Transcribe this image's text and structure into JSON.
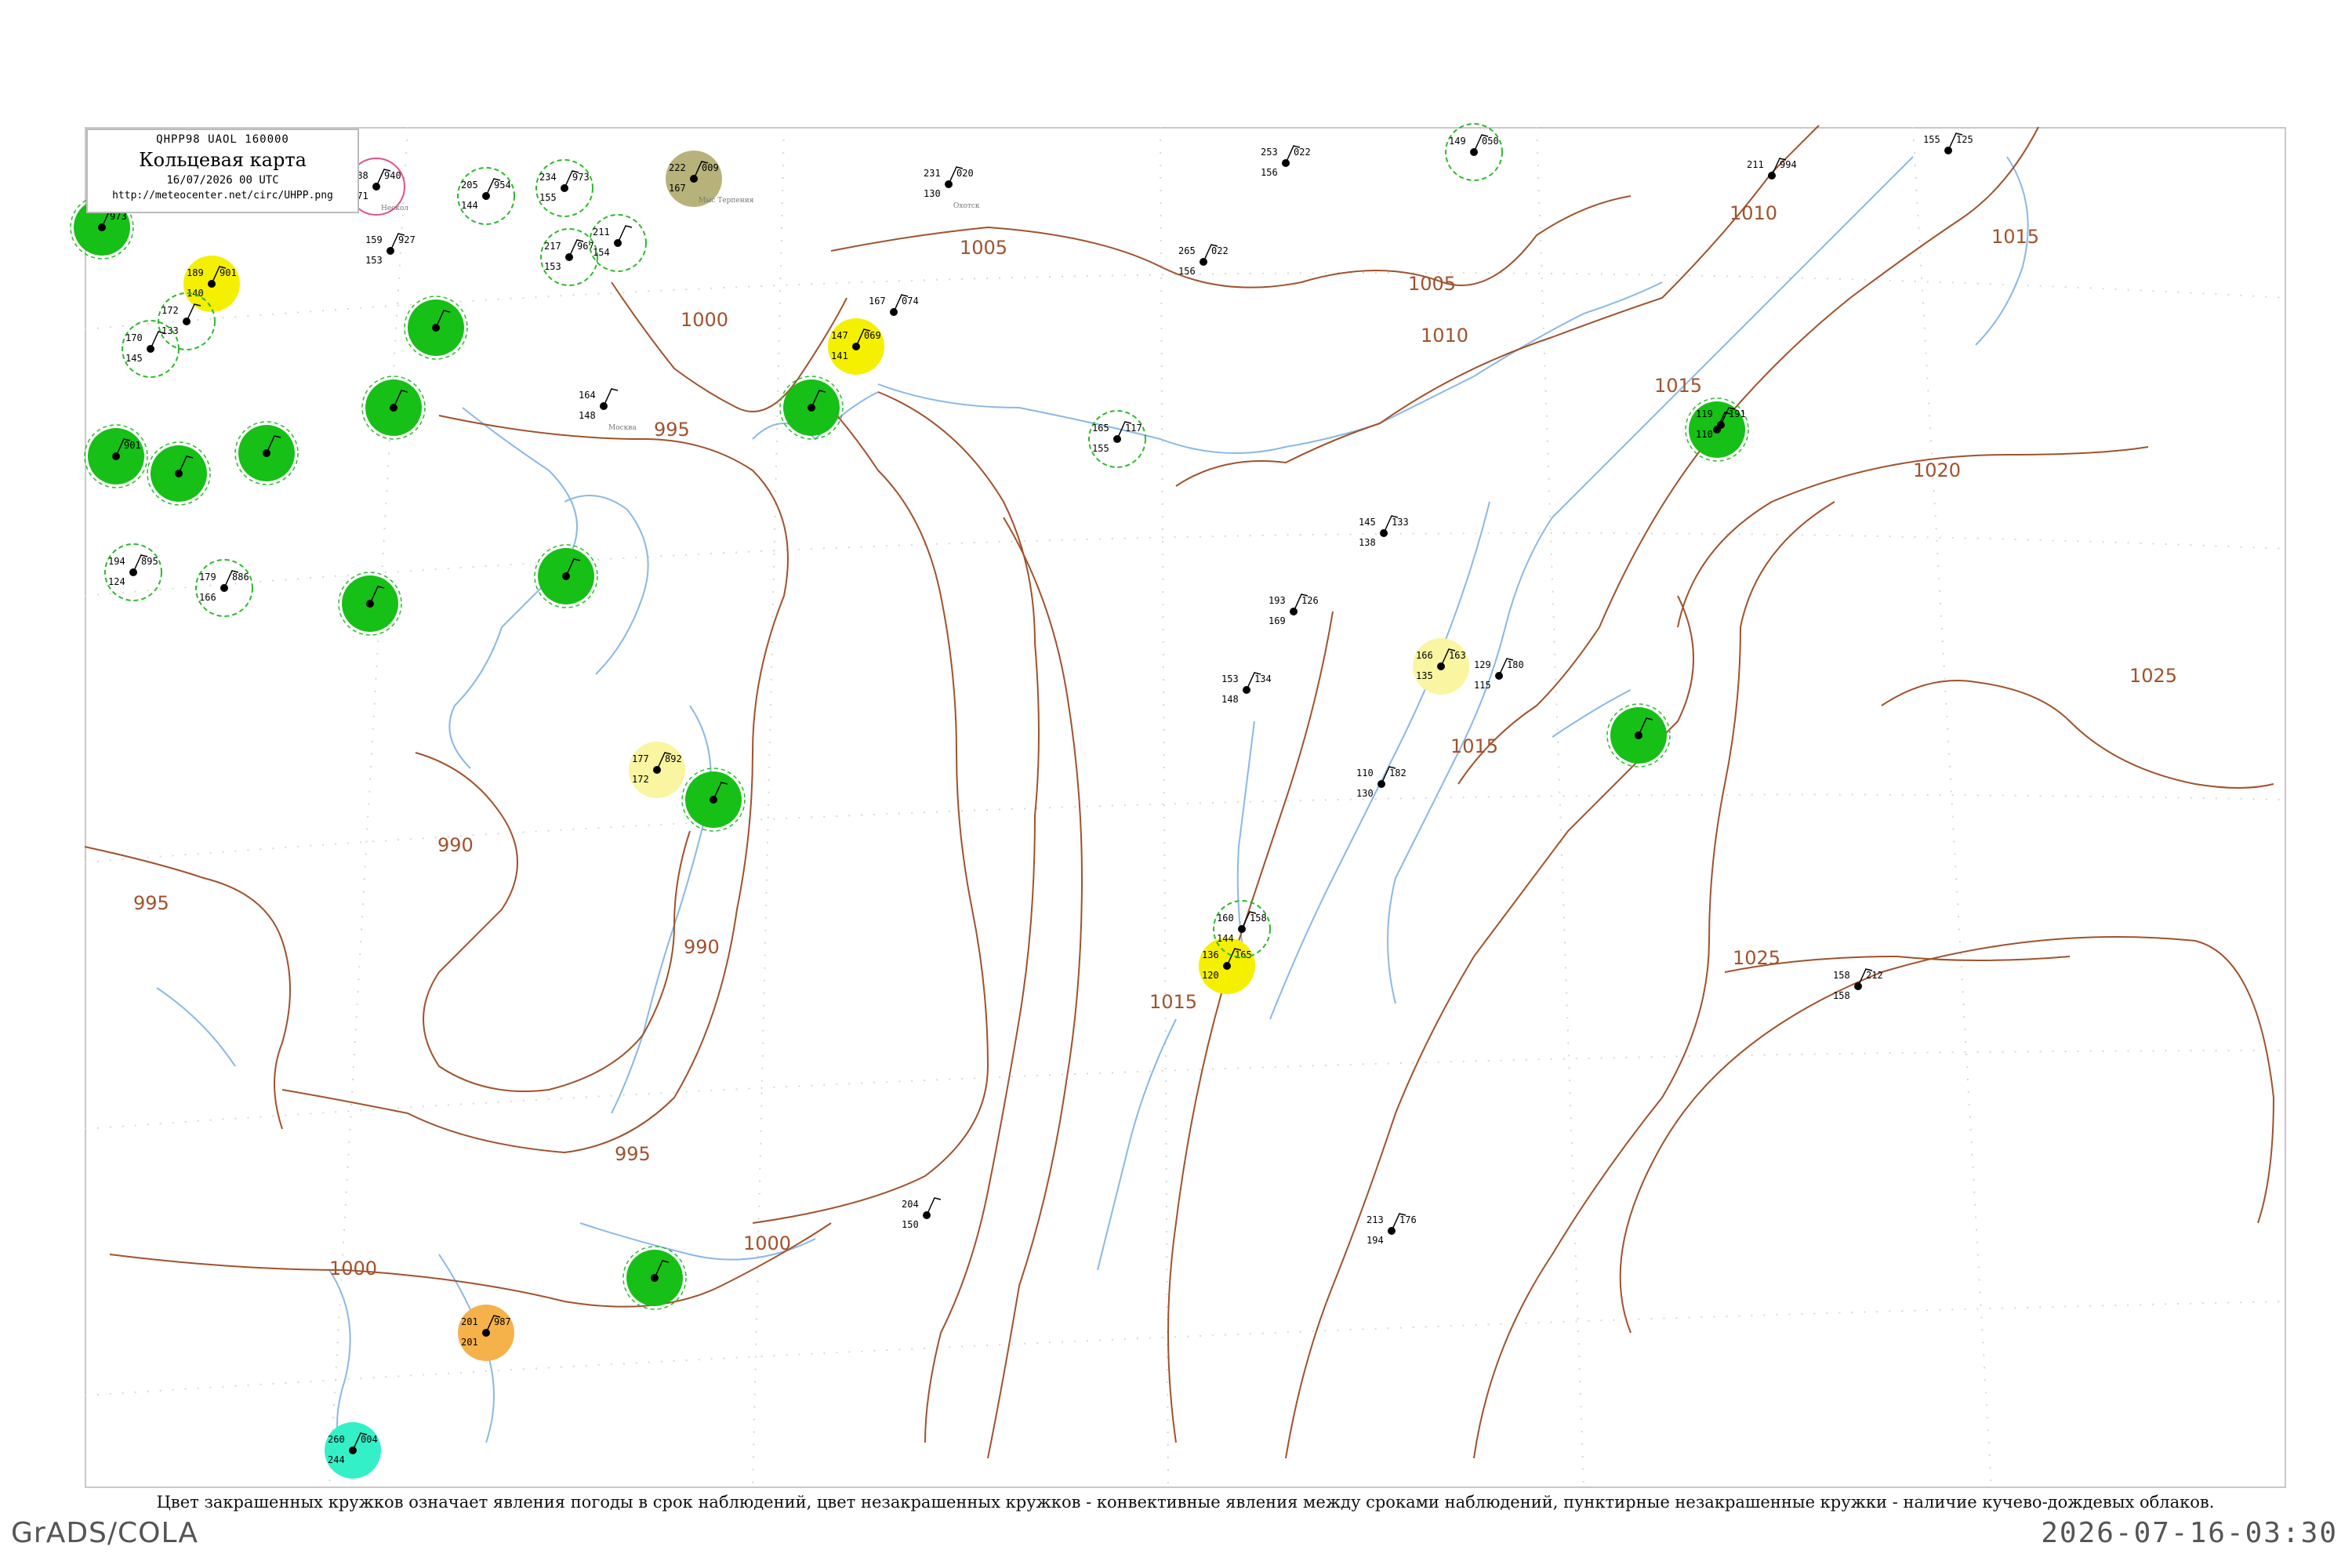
{
  "title": {
    "code": "QHPP98  UAOL  160000",
    "name": "Кольцевая карта",
    "date": "16/07/2026 00 UTC",
    "url": "http://meteocenter.net/circ/UHPP.png"
  },
  "caption": "Цвет закрашенных кружков означает явления погоды в срок наблюдений, цвет незакрашенных кружков - конвективные явления между сроками наблюдений, пунктирные незакрашенные кружки - наличие кучево-дождевых облаков.",
  "footer": {
    "software": "GrADS/COLA",
    "timestamp": "2026-07-16-03:30"
  },
  "colors": {
    "isobar": "#a0522d",
    "river": "#8ab8e6",
    "station_green": "#16c016",
    "station_yellow": "#f5f000",
    "station_paleyellow": "#faf5a0",
    "station_olive": "#b7b27a",
    "station_orange": "#f5b24a",
    "station_cyan": "#33f0c8",
    "ring_green": "#2db82d",
    "ring_pink": "#e0508a"
  },
  "isobar_labels": [
    "1005",
    "1005",
    "1010",
    "1010",
    "1015",
    "1015",
    "1015",
    "1020",
    "1025",
    "1025",
    "1000",
    "995",
    "995",
    "990",
    "990",
    "995",
    "1000",
    "1000",
    "1015"
  ],
  "stations": [
    {
      "id": "s1",
      "fill": "green",
      "t": "",
      "p": "973",
      "td": "",
      "name": ""
    },
    {
      "id": "s2",
      "fill": "none-pink",
      "t": "188",
      "p": "940",
      "td": "171",
      "name": "Нескол"
    },
    {
      "id": "s3",
      "fill": "none-ring",
      "t": "205",
      "p": "954",
      "td": "144",
      "name": ""
    },
    {
      "id": "s4",
      "fill": "none-ring",
      "t": "234",
      "p": "973",
      "td": "155",
      "name": ""
    },
    {
      "id": "s5",
      "fill": "olive",
      "t": "222",
      "p": "009",
      "td": "167",
      "name": "Мыс Терпения"
    },
    {
      "id": "s6",
      "fill": "none",
      "t": "231",
      "p": "020",
      "td": "130",
      "name": "Охотск"
    },
    {
      "id": "s7",
      "fill": "none",
      "t": "253",
      "p": "022",
      "td": "156",
      "name": ""
    },
    {
      "id": "s8",
      "fill": "none-ring",
      "t": "149",
      "p": "050",
      "td": "",
      "name": ""
    },
    {
      "id": "s9",
      "fill": "none",
      "t": "155",
      "p": "125",
      "td": "",
      "name": ""
    },
    {
      "id": "s10",
      "fill": "none",
      "t": "211",
      "p": "994",
      "td": "",
      "name": ""
    },
    {
      "id": "s11",
      "fill": "yellow",
      "t": "189",
      "p": "901",
      "td": "140",
      "name": ""
    },
    {
      "id": "s12",
      "fill": "none-ring",
      "t": "172",
      "p": "",
      "td": "133",
      "name": ""
    },
    {
      "id": "s13",
      "fill": "none-ring",
      "t": "170",
      "p": "",
      "td": "145",
      "name": ""
    },
    {
      "id": "s14",
      "fill": "green",
      "t": "",
      "p": "",
      "td": "",
      "name": ""
    },
    {
      "id": "s15",
      "fill": "green",
      "t": "",
      "p": "",
      "td": "",
      "name": ""
    },
    {
      "id": "s16",
      "fill": "none",
      "t": "159",
      "p": "927",
      "td": "153",
      "name": ""
    },
    {
      "id": "s17",
      "fill": "none-ring",
      "t": "217",
      "p": "967",
      "td": "153",
      "name": ""
    },
    {
      "id": "s18",
      "fill": "none-ring",
      "t": "211",
      "p": "",
      "td": "154",
      "name": ""
    },
    {
      "id": "s19",
      "fill": "none",
      "t": "265",
      "p": "022",
      "td": "156",
      "name": ""
    },
    {
      "id": "s20",
      "fill": "yellow",
      "t": "147",
      "p": "069",
      "td": "141",
      "name": ""
    },
    {
      "id": "s21",
      "fill": "none",
      "t": "167",
      "p": "074",
      "td": "",
      "name": ""
    },
    {
      "id": "s22",
      "fill": "green",
      "t": "",
      "p": "",
      "td": "",
      "name": ""
    },
    {
      "id": "s23",
      "fill": "none",
      "t": "164",
      "p": "",
      "td": "148",
      "name": "Москва"
    },
    {
      "id": "s24",
      "fill": "none-ring",
      "t": "165",
      "p": "117",
      "td": "155",
      "name": ""
    },
    {
      "id": "s25",
      "fill": "green",
      "t": "",
      "p": "901",
      "td": "",
      "name": ""
    },
    {
      "id": "s26",
      "fill": "green",
      "t": "",
      "p": "",
      "td": "",
      "name": ""
    },
    {
      "id": "s27",
      "fill": "green",
      "t": "",
      "p": "",
      "td": "",
      "name": ""
    },
    {
      "id": "s28",
      "fill": "green",
      "t": "",
      "p": "",
      "td": "",
      "name": ""
    },
    {
      "id": "s29",
      "fill": "none",
      "t": "119",
      "p": "191",
      "td": "110",
      "name": ""
    },
    {
      "id": "s30",
      "fill": "none",
      "t": "145",
      "p": "133",
      "td": "138",
      "name": ""
    },
    {
      "id": "s31",
      "fill": "none-ring",
      "t": "194",
      "p": "895",
      "td": "124",
      "name": ""
    },
    {
      "id": "s32",
      "fill": "none-ring",
      "t": "179",
      "p": "886",
      "td": "166",
      "name": ""
    },
    {
      "id": "s33",
      "fill": "green",
      "t": "",
      "p": "",
      "td": "",
      "name": ""
    },
    {
      "id": "s34",
      "fill": "green",
      "t": "",
      "p": "",
      "td": "",
      "name": ""
    },
    {
      "id": "s35",
      "fill": "none",
      "t": "193",
      "p": "126",
      "td": "169",
      "name": ""
    },
    {
      "id": "s36",
      "fill": "paleyellow",
      "t": "166",
      "p": "163",
      "td": "135",
      "name": ""
    },
    {
      "id": "s37",
      "fill": "none",
      "t": "153",
      "p": "134",
      "td": "148",
      "name": ""
    },
    {
      "id": "s38",
      "fill": "none",
      "t": "129",
      "p": "180",
      "td": "115",
      "name": ""
    },
    {
      "id": "s39",
      "fill": "green",
      "t": "",
      "p": "",
      "td": "",
      "name": ""
    },
    {
      "id": "s40",
      "fill": "paleyellow",
      "t": "177",
      "p": "892",
      "td": "172",
      "name": ""
    },
    {
      "id": "s41",
      "fill": "green",
      "t": "",
      "p": "",
      "td": "",
      "name": ""
    },
    {
      "id": "s42",
      "fill": "none",
      "t": "110",
      "p": "182",
      "td": "130",
      "name": ""
    },
    {
      "id": "s43",
      "fill": "yellow",
      "t": "136",
      "p": "165",
      "td": "120",
      "name": ""
    },
    {
      "id": "s44",
      "fill": "none-ring",
      "t": "160",
      "p": "158",
      "td": "144",
      "name": ""
    },
    {
      "id": "s45",
      "fill": "none",
      "t": "158",
      "p": "212",
      "td": "158",
      "name": ""
    },
    {
      "id": "s46",
      "fill": "orange",
      "t": "201",
      "p": "987",
      "td": "201",
      "name": ""
    },
    {
      "id": "s47",
      "fill": "cyan",
      "t": "260",
      "p": "004",
      "td": "244",
      "name": ""
    },
    {
      "id": "s48",
      "fill": "green",
      "t": "",
      "p": "",
      "td": "",
      "name": ""
    },
    {
      "id": "s49",
      "fill": "none",
      "t": "204",
      "p": "",
      "td": "150",
      "name": ""
    },
    {
      "id": "s50",
      "fill": "none",
      "t": "213",
      "p": "176",
      "td": "194",
      "name": ""
    }
  ]
}
